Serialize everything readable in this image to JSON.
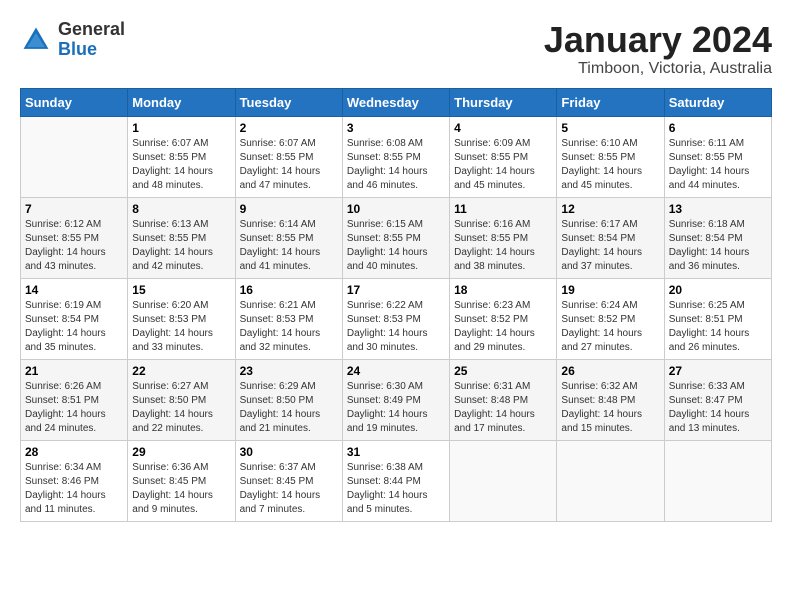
{
  "header": {
    "logo_general": "General",
    "logo_blue": "Blue",
    "month_year": "January 2024",
    "location": "Timboon, Victoria, Australia"
  },
  "calendar": {
    "days_of_week": [
      "Sunday",
      "Monday",
      "Tuesday",
      "Wednesday",
      "Thursday",
      "Friday",
      "Saturday"
    ],
    "weeks": [
      [
        {
          "num": "",
          "sunrise": "",
          "sunset": "",
          "daylight": "",
          "empty": true
        },
        {
          "num": "1",
          "sunrise": "Sunrise: 6:07 AM",
          "sunset": "Sunset: 8:55 PM",
          "daylight": "Daylight: 14 hours and 48 minutes."
        },
        {
          "num": "2",
          "sunrise": "Sunrise: 6:07 AM",
          "sunset": "Sunset: 8:55 PM",
          "daylight": "Daylight: 14 hours and 47 minutes."
        },
        {
          "num": "3",
          "sunrise": "Sunrise: 6:08 AM",
          "sunset": "Sunset: 8:55 PM",
          "daylight": "Daylight: 14 hours and 46 minutes."
        },
        {
          "num": "4",
          "sunrise": "Sunrise: 6:09 AM",
          "sunset": "Sunset: 8:55 PM",
          "daylight": "Daylight: 14 hours and 45 minutes."
        },
        {
          "num": "5",
          "sunrise": "Sunrise: 6:10 AM",
          "sunset": "Sunset: 8:55 PM",
          "daylight": "Daylight: 14 hours and 45 minutes."
        },
        {
          "num": "6",
          "sunrise": "Sunrise: 6:11 AM",
          "sunset": "Sunset: 8:55 PM",
          "daylight": "Daylight: 14 hours and 44 minutes."
        }
      ],
      [
        {
          "num": "7",
          "sunrise": "Sunrise: 6:12 AM",
          "sunset": "Sunset: 8:55 PM",
          "daylight": "Daylight: 14 hours and 43 minutes."
        },
        {
          "num": "8",
          "sunrise": "Sunrise: 6:13 AM",
          "sunset": "Sunset: 8:55 PM",
          "daylight": "Daylight: 14 hours and 42 minutes."
        },
        {
          "num": "9",
          "sunrise": "Sunrise: 6:14 AM",
          "sunset": "Sunset: 8:55 PM",
          "daylight": "Daylight: 14 hours and 41 minutes."
        },
        {
          "num": "10",
          "sunrise": "Sunrise: 6:15 AM",
          "sunset": "Sunset: 8:55 PM",
          "daylight": "Daylight: 14 hours and 40 minutes."
        },
        {
          "num": "11",
          "sunrise": "Sunrise: 6:16 AM",
          "sunset": "Sunset: 8:55 PM",
          "daylight": "Daylight: 14 hours and 38 minutes."
        },
        {
          "num": "12",
          "sunrise": "Sunrise: 6:17 AM",
          "sunset": "Sunset: 8:54 PM",
          "daylight": "Daylight: 14 hours and 37 minutes."
        },
        {
          "num": "13",
          "sunrise": "Sunrise: 6:18 AM",
          "sunset": "Sunset: 8:54 PM",
          "daylight": "Daylight: 14 hours and 36 minutes."
        }
      ],
      [
        {
          "num": "14",
          "sunrise": "Sunrise: 6:19 AM",
          "sunset": "Sunset: 8:54 PM",
          "daylight": "Daylight: 14 hours and 35 minutes."
        },
        {
          "num": "15",
          "sunrise": "Sunrise: 6:20 AM",
          "sunset": "Sunset: 8:53 PM",
          "daylight": "Daylight: 14 hours and 33 minutes."
        },
        {
          "num": "16",
          "sunrise": "Sunrise: 6:21 AM",
          "sunset": "Sunset: 8:53 PM",
          "daylight": "Daylight: 14 hours and 32 minutes."
        },
        {
          "num": "17",
          "sunrise": "Sunrise: 6:22 AM",
          "sunset": "Sunset: 8:53 PM",
          "daylight": "Daylight: 14 hours and 30 minutes."
        },
        {
          "num": "18",
          "sunrise": "Sunrise: 6:23 AM",
          "sunset": "Sunset: 8:52 PM",
          "daylight": "Daylight: 14 hours and 29 minutes."
        },
        {
          "num": "19",
          "sunrise": "Sunrise: 6:24 AM",
          "sunset": "Sunset: 8:52 PM",
          "daylight": "Daylight: 14 hours and 27 minutes."
        },
        {
          "num": "20",
          "sunrise": "Sunrise: 6:25 AM",
          "sunset": "Sunset: 8:51 PM",
          "daylight": "Daylight: 14 hours and 26 minutes."
        }
      ],
      [
        {
          "num": "21",
          "sunrise": "Sunrise: 6:26 AM",
          "sunset": "Sunset: 8:51 PM",
          "daylight": "Daylight: 14 hours and 24 minutes."
        },
        {
          "num": "22",
          "sunrise": "Sunrise: 6:27 AM",
          "sunset": "Sunset: 8:50 PM",
          "daylight": "Daylight: 14 hours and 22 minutes."
        },
        {
          "num": "23",
          "sunrise": "Sunrise: 6:29 AM",
          "sunset": "Sunset: 8:50 PM",
          "daylight": "Daylight: 14 hours and 21 minutes."
        },
        {
          "num": "24",
          "sunrise": "Sunrise: 6:30 AM",
          "sunset": "Sunset: 8:49 PM",
          "daylight": "Daylight: 14 hours and 19 minutes."
        },
        {
          "num": "25",
          "sunrise": "Sunrise: 6:31 AM",
          "sunset": "Sunset: 8:48 PM",
          "daylight": "Daylight: 14 hours and 17 minutes."
        },
        {
          "num": "26",
          "sunrise": "Sunrise: 6:32 AM",
          "sunset": "Sunset: 8:48 PM",
          "daylight": "Daylight: 14 hours and 15 minutes."
        },
        {
          "num": "27",
          "sunrise": "Sunrise: 6:33 AM",
          "sunset": "Sunset: 8:47 PM",
          "daylight": "Daylight: 14 hours and 13 minutes."
        }
      ],
      [
        {
          "num": "28",
          "sunrise": "Sunrise: 6:34 AM",
          "sunset": "Sunset: 8:46 PM",
          "daylight": "Daylight: 14 hours and 11 minutes."
        },
        {
          "num": "29",
          "sunrise": "Sunrise: 6:36 AM",
          "sunset": "Sunset: 8:45 PM",
          "daylight": "Daylight: 14 hours and 9 minutes."
        },
        {
          "num": "30",
          "sunrise": "Sunrise: 6:37 AM",
          "sunset": "Sunset: 8:45 PM",
          "daylight": "Daylight: 14 hours and 7 minutes."
        },
        {
          "num": "31",
          "sunrise": "Sunrise: 6:38 AM",
          "sunset": "Sunset: 8:44 PM",
          "daylight": "Daylight: 14 hours and 5 minutes."
        },
        {
          "num": "",
          "sunrise": "",
          "sunset": "",
          "daylight": "",
          "empty": true
        },
        {
          "num": "",
          "sunrise": "",
          "sunset": "",
          "daylight": "",
          "empty": true
        },
        {
          "num": "",
          "sunrise": "",
          "sunset": "",
          "daylight": "",
          "empty": true
        }
      ]
    ]
  }
}
